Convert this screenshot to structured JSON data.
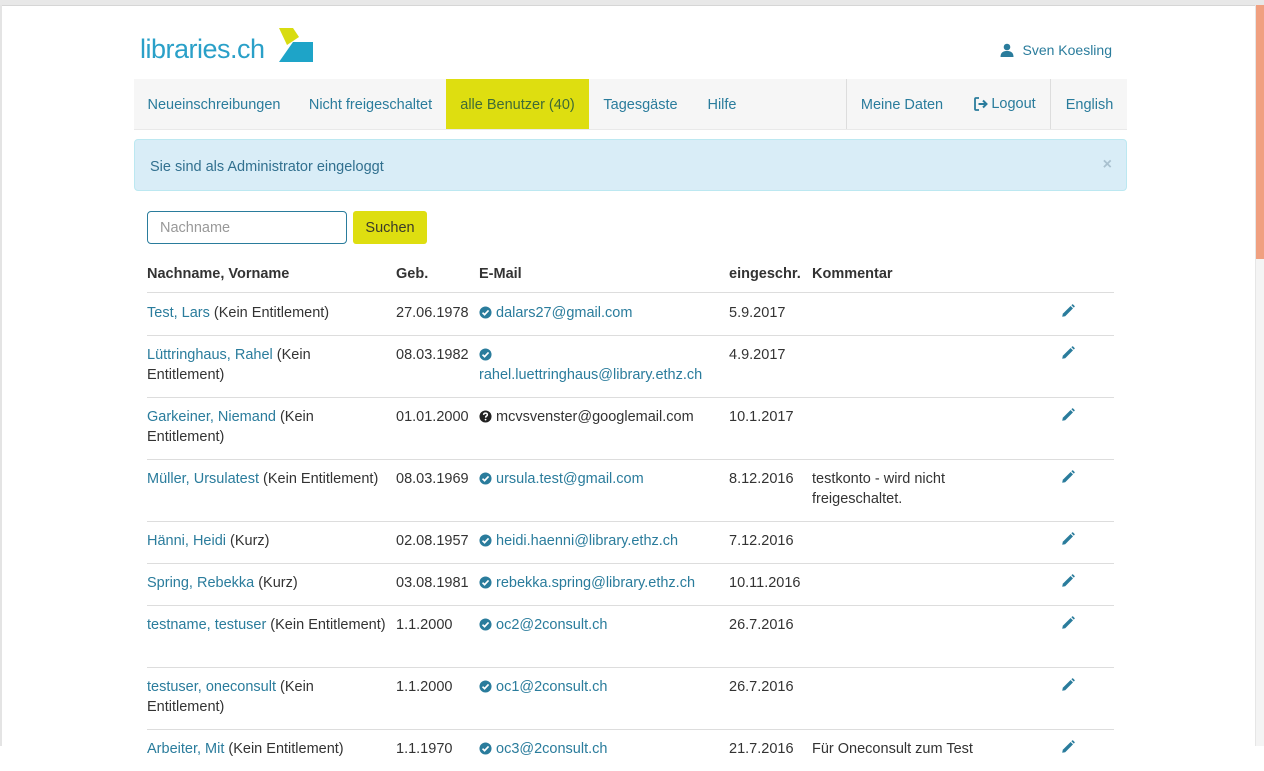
{
  "logo": {
    "text": "libraries.ch"
  },
  "user": {
    "name": "Sven Koesling",
    "icon": "user-icon"
  },
  "nav": {
    "left": [
      {
        "label": "Neueinschreibungen"
      },
      {
        "label": "Nicht freigeschaltet"
      },
      {
        "label": "alle Benutzer (40)",
        "active": true
      },
      {
        "label": "Tagesgäste"
      },
      {
        "label": "Hilfe"
      }
    ],
    "right": [
      {
        "label": "Meine Daten"
      },
      {
        "label": "Logout",
        "icon": "logout-icon"
      },
      {
        "label": "English"
      }
    ]
  },
  "alert": {
    "text": "Sie sind als Administrator eingeloggt",
    "close": "×"
  },
  "search": {
    "placeholder": "Nachname",
    "button": "Suchen"
  },
  "table": {
    "headers": [
      "Nachname, Vorname",
      "Geb.",
      "E-Mail",
      "eingeschr.",
      "Kommentar"
    ],
    "rows": [
      {
        "name": "Test, Lars",
        "suffix": " (Kein Entitlement)",
        "birth": "27.06.1978",
        "email": "dalars27@gmail.com",
        "verified": true,
        "registered": "5.9.2017",
        "comment": ""
      },
      {
        "name": "Lüttringhaus, Rahel",
        "suffix": " (Kein Entitlement)",
        "birth": "08.03.1982",
        "email": "rahel.luettringhaus@library.ethz.ch",
        "verified": true,
        "registered": "4.9.2017",
        "comment": ""
      },
      {
        "name": "Garkeiner, Niemand",
        "suffix": " (Kein Entitlement)",
        "birth": "01.01.2000",
        "email": "mcvsvenster@googlemail.com",
        "verified": false,
        "registered": "10.1.2017",
        "comment": ""
      },
      {
        "name": "Müller, Ursulatest",
        "suffix": " (Kein Entitlement)",
        "birth": "08.03.1969",
        "email": "ursula.test@gmail.com",
        "verified": true,
        "registered": "8.12.2016",
        "comment": "testkonto - wird nicht freigeschaltet."
      },
      {
        "name": "Hänni, Heidi",
        "suffix": " (Kurz)",
        "birth": "02.08.1957",
        "email": "heidi.haenni@library.ethz.ch",
        "verified": true,
        "registered": "7.12.2016",
        "comment": ""
      },
      {
        "name": "Spring, Rebekka",
        "suffix": " (Kurz)",
        "birth": "03.08.1981",
        "email": "rebekka.spring@library.ethz.ch",
        "verified": true,
        "registered": "10.11.2016",
        "comment": ""
      },
      {
        "name": "testname, testuser",
        "suffix": " (Kein Entitlement)",
        "birth": "1.1.2000",
        "email": "oc2@2consult.ch",
        "verified": true,
        "registered": "26.7.2016",
        "comment": ""
      },
      {
        "name": "testuser, oneconsult",
        "suffix": " (Kein Entitlement)",
        "birth": "1.1.2000",
        "email": "oc1@2consult.ch",
        "verified": true,
        "registered": "26.7.2016",
        "comment": ""
      },
      {
        "name": "Arbeiter, Mit",
        "suffix": " (Kein Entitlement)",
        "birth": "1.1.1970",
        "email": "oc3@2consult.ch",
        "verified": true,
        "registered": "21.7.2016",
        "comment": "Für Oneconsult zum Test"
      }
    ]
  },
  "colors": {
    "accent": "#dede10",
    "link": "#2a7c9c",
    "alert_bg": "#d9edf7",
    "scroll_thumb": "#f0a080"
  }
}
